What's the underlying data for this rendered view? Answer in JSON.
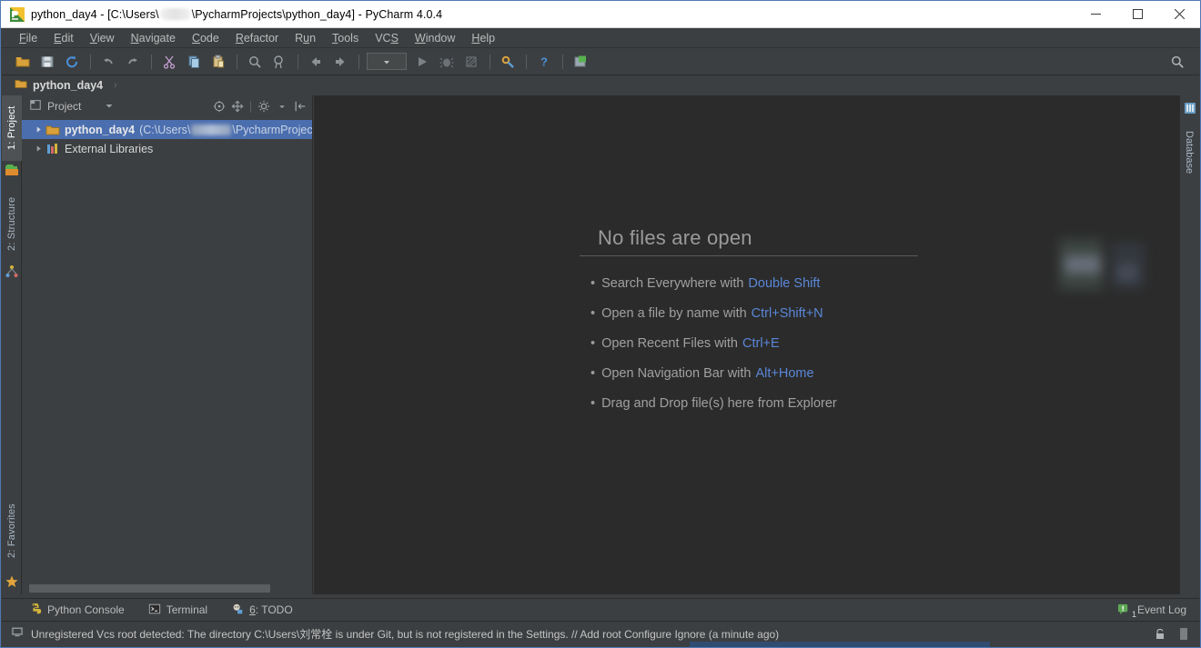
{
  "window": {
    "title_app": "python_day4",
    "title_full": "python_day4 - [C:\\Users\\",
    "title_tail": "\\PycharmProjects\\python_day4] - PyCharm 4.0.4",
    "icon": "pycharm-logo-icon",
    "controls": {
      "minimize": "minimize-window-button",
      "maximize": "maximize-window-button",
      "close": "close-window-button"
    }
  },
  "menubar": {
    "items": [
      {
        "label": "File",
        "mnemonic": "F"
      },
      {
        "label": "Edit",
        "mnemonic": "E"
      },
      {
        "label": "View",
        "mnemonic": "V"
      },
      {
        "label": "Navigate",
        "mnemonic": "N"
      },
      {
        "label": "Code",
        "mnemonic": "C"
      },
      {
        "label": "Refactor",
        "mnemonic": "R"
      },
      {
        "label": "Run",
        "mnemonic": "u"
      },
      {
        "label": "Tools",
        "mnemonic": "T"
      },
      {
        "label": "VCS",
        "mnemonic": "S"
      },
      {
        "label": "Window",
        "mnemonic": "W"
      },
      {
        "label": "Help",
        "mnemonic": "H"
      }
    ]
  },
  "toolbar": {
    "buttons": [
      "open-folder-icon",
      "save-all-icon",
      "synchronize-icon",
      "undo-icon",
      "redo-icon",
      "cut-icon",
      "copy-icon",
      "paste-icon",
      "find-icon",
      "replace-icon",
      "navigate-back-icon",
      "navigate-forward-icon"
    ],
    "run_config_placeholder": "",
    "run_buttons": [
      "run-icon",
      "debug-icon",
      "coverage-icon"
    ],
    "trailing": [
      "settings-icon",
      "help-icon",
      "update-icon"
    ],
    "search": "search-icon"
  },
  "navbar": {
    "crumb_label": "python_day4",
    "crumb_icon": "folder-icon"
  },
  "left_tool_strip": {
    "tabs": [
      {
        "label": "1: Project",
        "icon": "project-icon",
        "active": true
      },
      {
        "label": "2: Structure",
        "icon": "structure-icon",
        "active": false
      },
      {
        "label": "2: Favorites",
        "icon": "star-icon",
        "active": false
      }
    ]
  },
  "right_tool_strip": {
    "tabs": [
      {
        "label": "Database",
        "icon": "database-icon"
      }
    ]
  },
  "project_panel": {
    "title": "Project",
    "title_icon": "project-view-icon",
    "dropdown_icon": "chevron-down-icon",
    "actions": [
      "scroll-from-source-icon",
      "collapse-all-icon",
      "settings-gear-icon",
      "hide-panel-icon"
    ],
    "tree": [
      {
        "name": "python_day4",
        "path_prefix": "(C:\\Users\\",
        "path_suffix": "\\PycharmProjects\\",
        "icon": "folder-icon",
        "expander": "collapsed-arrow",
        "selected": true,
        "bold": true
      },
      {
        "name": "External Libraries",
        "path_prefix": "",
        "path_suffix": "",
        "icon": "library-icon",
        "expander": "collapsed-arrow",
        "selected": false,
        "bold": false
      }
    ]
  },
  "editor": {
    "empty_title": "No files are open",
    "hints": [
      {
        "text": "Search Everywhere with",
        "key": "Double Shift"
      },
      {
        "text": "Open a file by name with",
        "key": "Ctrl+Shift+N"
      },
      {
        "text": "Open Recent Files with",
        "key": "Ctrl+E"
      },
      {
        "text": "Open Navigation Bar with",
        "key": "Alt+Home"
      },
      {
        "text": "Drag and Drop file(s) here from Explorer",
        "key": ""
      }
    ],
    "key_color": "#5a87d8"
  },
  "toolwindow_bar": {
    "items": [
      {
        "label": "Python Console",
        "icon": "python-console-icon",
        "mnemonic": ""
      },
      {
        "label": "Terminal",
        "icon": "terminal-icon",
        "mnemonic": ""
      },
      {
        "label": "6: TODO",
        "icon": "todo-icon",
        "mnemonic": "6"
      }
    ],
    "event_log": {
      "label": "Event Log",
      "icon": "event-log-icon",
      "count": "1"
    }
  },
  "statusbar": {
    "icon": "info-icon",
    "message": "Unregistered Vcs root detected: The directory C:\\Users\\刘常栓 is under Git, but is not registered in the Settings. // Add root  Configure  Ignore (a minute ago)",
    "right_icons": [
      "lock-icon",
      "memory-icon"
    ]
  }
}
